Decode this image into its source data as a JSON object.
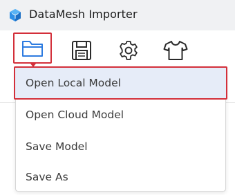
{
  "window": {
    "title": "DataMesh Importer",
    "logo_icon": "datamesh-cube-logo"
  },
  "toolbar": {
    "buttons": [
      {
        "name": "open",
        "icon": "folder-icon",
        "selected": true
      },
      {
        "name": "save",
        "icon": "floppy-disk-icon",
        "selected": false
      },
      {
        "name": "settings",
        "icon": "gear-icon",
        "selected": false
      },
      {
        "name": "theme",
        "icon": "tshirt-icon",
        "selected": false
      }
    ],
    "accent_color": "#d32f3a"
  },
  "menu": {
    "items": [
      {
        "label": "Open Local Model",
        "highlighted": true
      },
      {
        "label": "Open Cloud Model",
        "highlighted": false
      },
      {
        "label": "Save Model",
        "highlighted": false
      },
      {
        "label": "Save As",
        "highlighted": false
      }
    ]
  }
}
